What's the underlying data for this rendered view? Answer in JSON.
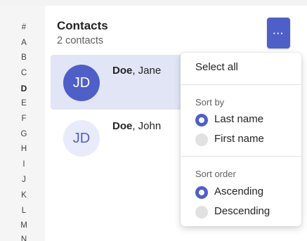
{
  "alphabet": [
    "#",
    "A",
    "B",
    "C",
    "D",
    "E",
    "F",
    "G",
    "H",
    "I",
    "J",
    "K",
    "L",
    "M",
    "N"
  ],
  "alphabet_active": "D",
  "header": {
    "title": "Contacts",
    "subtitle": "2 contacts",
    "more_label": "···"
  },
  "contacts": [
    {
      "initials": "JD",
      "last": "Doe",
      "rest": ", Jane",
      "selected": true
    },
    {
      "initials": "JD",
      "last": "Doe",
      "rest": ", John",
      "selected": false
    }
  ],
  "menu": {
    "select_all": "Select all",
    "sort_by": {
      "heading": "Sort by",
      "options": [
        {
          "label": "Last name",
          "checked": true
        },
        {
          "label": "First name",
          "checked": false
        }
      ]
    },
    "sort_order": {
      "heading": "Sort order",
      "options": [
        {
          "label": "Ascending",
          "checked": true
        },
        {
          "label": "Descending",
          "checked": false
        }
      ]
    }
  },
  "colors": {
    "accent": "#4f5fc8",
    "selected_row": "#e1e5f5",
    "light_avatar": "#e8ebfa"
  }
}
